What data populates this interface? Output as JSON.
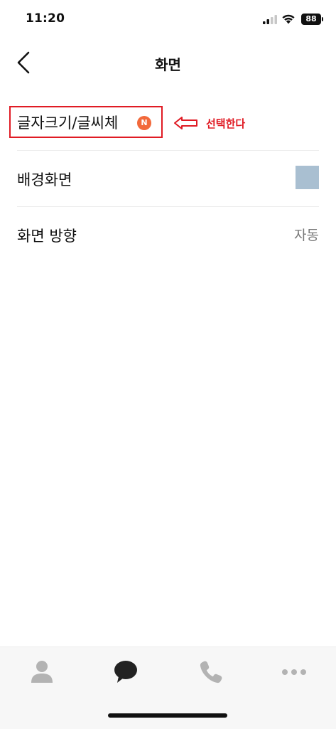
{
  "status_bar": {
    "time": "11:20",
    "battery": "88"
  },
  "header": {
    "title": "화면",
    "back_icon": "chevron-left-icon"
  },
  "settings": {
    "font": {
      "label": "글자크기/글씨체",
      "badge": "N",
      "badge_color": "#f2693b"
    },
    "background": {
      "label": "배경화면",
      "swatch_color": "#a9bfd1"
    },
    "orientation": {
      "label": "화면 방향",
      "value": "자동"
    }
  },
  "annotation": {
    "text": "선택한다",
    "color": "#e01b24"
  },
  "tab_bar": {
    "tabs": [
      {
        "icon": "person-icon"
      },
      {
        "icon": "chat-bubble-icon"
      },
      {
        "icon": "phone-icon"
      },
      {
        "icon": "more-dots-icon"
      }
    ]
  }
}
